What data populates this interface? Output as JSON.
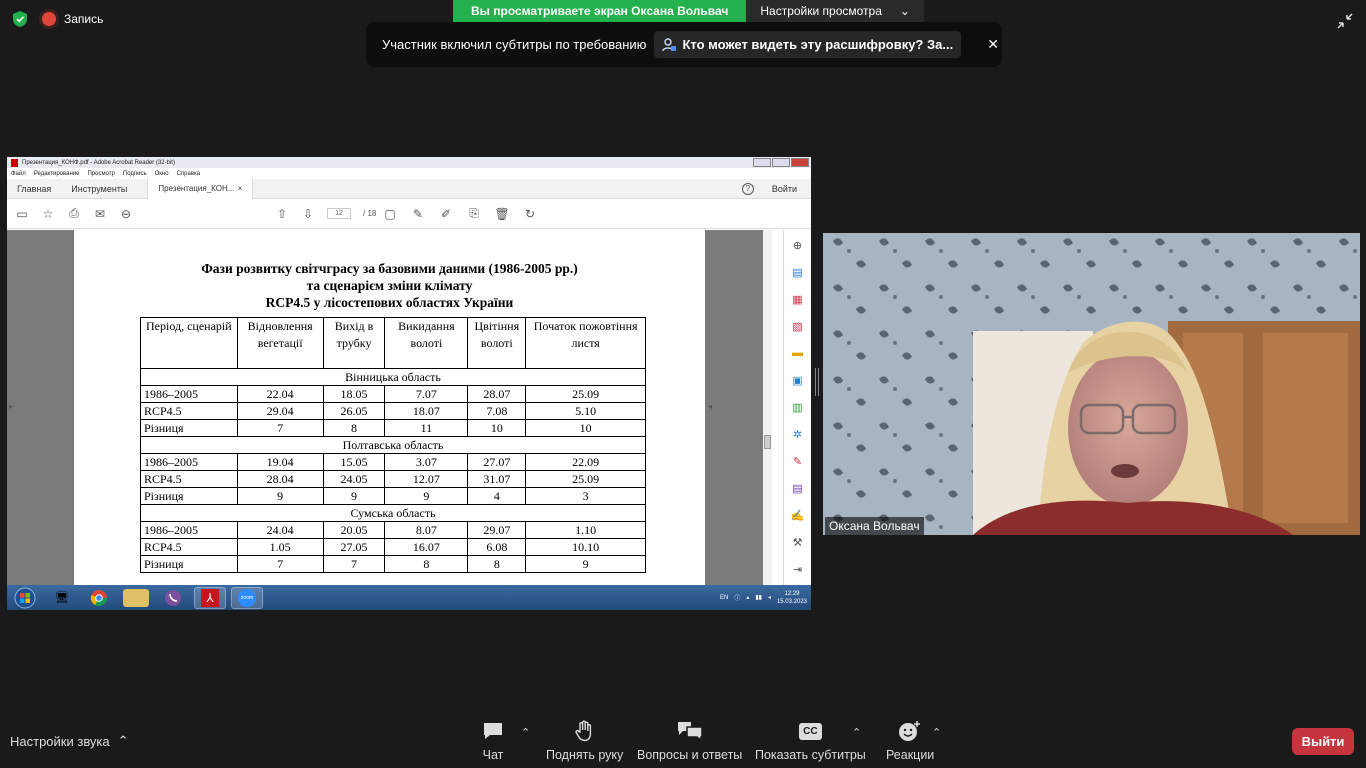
{
  "top": {
    "record_label": "Запись",
    "share_banner": "Вы просматриваете экран Оксана Вольвач",
    "view_options": "Настройки просмотра",
    "cc_notice": "Участник включил субтитры по требованию",
    "cc_link": "Кто может видеть эту расшифровку? За..."
  },
  "acrobat": {
    "window_title": "Презентация_КОНФ.pdf - Adobe Acrobat Reader (32-bit)",
    "menu": [
      "Файл",
      "Редактирование",
      "Просмотр",
      "Подпись",
      "Окно",
      "Справка"
    ],
    "tabs": {
      "home": "Главная",
      "tools": "Инструменты",
      "doc": "Презентация_КОН..."
    },
    "signin": "Войти",
    "help": "?",
    "page_current": "12",
    "page_total": "/ 18"
  },
  "document": {
    "title_line1": "Фази розвитку світчграсу  за базовими даними (1986-2005 рр.)",
    "title_line2": "та сценарієм зміни клімату",
    "title_line3": "RCP4.5 у лісостепових областях України"
  },
  "chart_data": {
    "type": "table",
    "columns": [
      "Період, сценарій",
      "Відновлення вегетації",
      "Вихід в трубку",
      "Викидання волоті",
      "Цвітіння волоті",
      "Початок пожовтіння листя"
    ],
    "groups": [
      {
        "region": "Вінницька область",
        "rows": [
          [
            "1986–2005",
            "22.04",
            "18.05",
            "7.07",
            "28.07",
            "25.09"
          ],
          [
            "RCP4.5",
            "29.04",
            "26.05",
            "18.07",
            "7.08",
            "5.10"
          ],
          [
            "Різниця",
            "7",
            "8",
            "11",
            "10",
            "10"
          ]
        ]
      },
      {
        "region": "Полтавська область",
        "rows": [
          [
            "1986–2005",
            "19.04",
            "15.05",
            "3.07",
            "27.07",
            "22.09"
          ],
          [
            "RCP4.5",
            "28.04",
            "24.05",
            "12.07",
            "31.07",
            "25.09"
          ],
          [
            "Різниця",
            "9",
            "9",
            "9",
            "4",
            "3"
          ]
        ]
      },
      {
        "region": "Сумська область",
        "rows": [
          [
            "1986–2005",
            "24.04",
            "20.05",
            "8.07",
            "29.07",
            "1.10"
          ],
          [
            "RCP4.5",
            "1.05",
            "27.05",
            "16.07",
            "6.08",
            "10.10"
          ],
          [
            "Різниця",
            "7",
            "7",
            "8",
            "8",
            "9"
          ]
        ]
      }
    ]
  },
  "taskbar": {
    "lang": "EN",
    "time": "12:29",
    "date": "15.03.2023",
    "zoom_label": "zoom"
  },
  "video": {
    "participant_name": "Оксана Вольвач"
  },
  "bottom": {
    "audio_settings": "Настройки звука",
    "chat": "Чат",
    "raise_hand": "Поднять руку",
    "qa": "Вопросы и ответы",
    "captions": "Показать субтитры",
    "cc_badge": "CC",
    "reactions": "Реакции",
    "exit": "Выйти"
  },
  "colors": {
    "share_green": "#23b14d",
    "exit_red": "#c6343d",
    "rec_red": "#e0453a"
  }
}
